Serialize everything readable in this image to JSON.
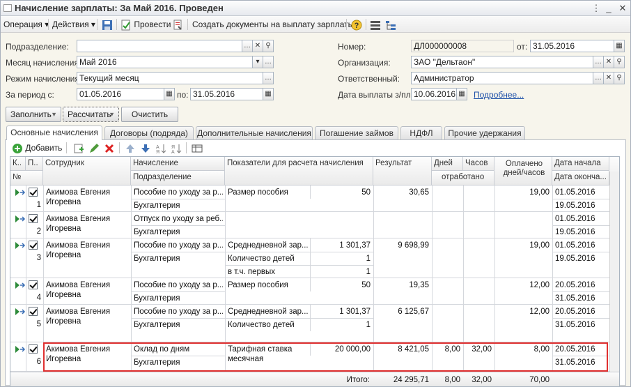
{
  "window": {
    "title": "Начисление зарплаты: За Май 2016. Проведен"
  },
  "toolbar": {
    "operation": "Операция",
    "actions": "Действия",
    "post": "Провести",
    "create_docs": "Создать документы на выплату зарплаты"
  },
  "form": {
    "dept_label": "Подразделение:",
    "dept_value": "",
    "month_label": "Месяц начисления:",
    "month_value": "Май 2016",
    "mode_label": "Режим начисления:",
    "mode_value": "Текущий месяц",
    "period_label": "За период с:",
    "period_from": "01.05.2016",
    "period_to_label": "по:",
    "period_to": "31.05.2016",
    "number_label": "Номер:",
    "number_value": "ДЛ000000008",
    "date_from_label": "от:",
    "date_value": "31.05.2016",
    "org_label": "Организация:",
    "org_value": "ЗАО \"Дельтаон\"",
    "resp_label": "Ответственный:",
    "resp_value": "Администратор",
    "pay_date_label": "Дата выплаты з/пл:",
    "pay_date_value": "10.06.2016",
    "more_link": "Подробнее...",
    "fill_btn": "Заполнить",
    "calc_btn": "Рассчитать",
    "clear_btn": "Очистить"
  },
  "tabs": [
    "Основные начисления",
    "Договоры (подряда)",
    "Дополнительные начисления",
    "Погашение займов",
    "НДФЛ",
    "Прочие удержания"
  ],
  "grid_toolbar": {
    "add": "Добавить"
  },
  "grid": {
    "headers": {
      "k": "К..",
      "p": "П..",
      "no": "№",
      "employee": "Сотрудник",
      "accrual": "Начисление",
      "subdivision": "Подразделение",
      "indicators": "Показатели для расчета начисления",
      "result": "Результат",
      "days": "Дней",
      "hours": "Часов",
      "worked": "отработано",
      "paid": "Оплачено дней/часов",
      "start": "Дата начала",
      "end": "Дата оконча..."
    },
    "rows": [
      {
        "no": "1",
        "emp1": "Акимова Евгения",
        "emp2": "Игоревна",
        "acc": "Пособие по уходу за р...",
        "sub": "Бухгалтерия",
        "ind": [
          [
            "Размер пособия",
            "50"
          ]
        ],
        "result": "30,65",
        "days": "",
        "hours": "",
        "paid": "19,00",
        "start": "01.05.2016",
        "end": "19.05.2016"
      },
      {
        "no": "2",
        "emp1": "Акимова Евгения",
        "emp2": "Игоревна",
        "acc": "Отпуск по уходу за реб...",
        "sub": "Бухгалтерия",
        "ind": [],
        "result": "",
        "days": "",
        "hours": "",
        "paid": "",
        "start": "01.05.2016",
        "end": "19.05.2016"
      },
      {
        "no": "3",
        "emp1": "Акимова Евгения",
        "emp2": "Игоревна",
        "acc": "Пособие по уходу за р...",
        "sub": "Бухгалтерия",
        "ind": [
          [
            "Среднедневной зар...",
            "1 301,37"
          ],
          [
            "Количество детей",
            "1"
          ],
          [
            "в т.ч. первых",
            "1"
          ]
        ],
        "result": "9 698,99",
        "days": "",
        "hours": "",
        "paid": "19,00",
        "start": "01.05.2016",
        "end": "19.05.2016"
      },
      {
        "no": "4",
        "emp1": "Акимова Евгения",
        "emp2": "Игоревна",
        "acc": "Пособие по уходу за р...",
        "sub": "Бухгалтерия",
        "ind": [
          [
            "Размер пособия",
            "50"
          ]
        ],
        "result": "19,35",
        "days": "",
        "hours": "",
        "paid": "12,00",
        "start": "20.05.2016",
        "end": "31.05.2016"
      },
      {
        "no": "5",
        "emp1": "Акимова Евгения",
        "emp2": "Игоревна",
        "acc": "Пособие по уходу за р...",
        "sub": "Бухгалтерия",
        "ind": [
          [
            "Среднедневной зар...",
            "1 301,37"
          ],
          [
            "Количество детей",
            "1"
          ]
        ],
        "result": "6 125,67",
        "days": "",
        "hours": "",
        "paid": "12,00",
        "start": "20.05.2016",
        "end": "31.05.2016"
      },
      {
        "no": "6",
        "emp1": "Акимова Евгения",
        "emp2": "Игоревна",
        "acc": "Оклад по дням",
        "sub": "Бухгалтерия",
        "ind": [
          [
            "Тарифная ставка месячная",
            "20 000,00"
          ]
        ],
        "result": "8 421,05",
        "days": "8,00",
        "hours": "32,00",
        "paid": "8,00",
        "start": "20.05.2016",
        "end": "31.05.2016"
      }
    ],
    "footer": {
      "label": "Итого:",
      "result": "24 295,71",
      "days": "8,00",
      "hours": "32,00",
      "paid": "70,00"
    }
  },
  "colors": {
    "highlight": "#e03030",
    "link": "#1c4fa8"
  }
}
